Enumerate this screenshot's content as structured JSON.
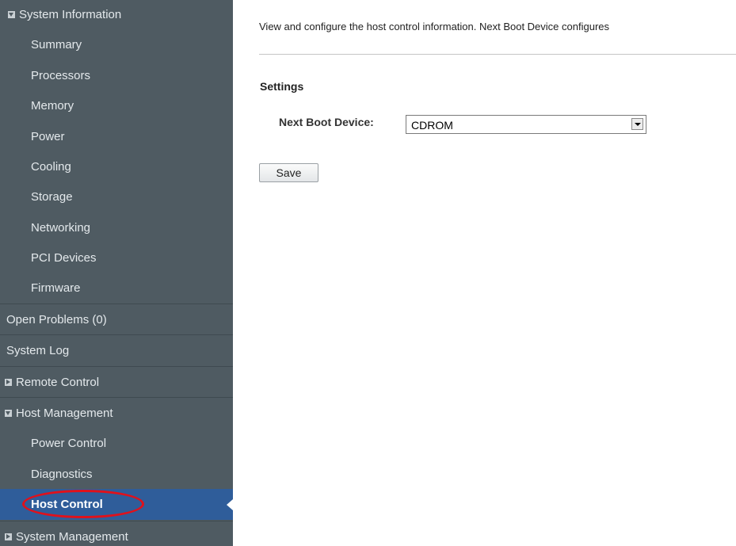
{
  "sidebar": {
    "system_information": "System Information",
    "summary": "Summary",
    "processors": "Processors",
    "memory": "Memory",
    "power": "Power",
    "cooling": "Cooling",
    "storage": "Storage",
    "networking": "Networking",
    "pci_devices": "PCI Devices",
    "firmware": "Firmware",
    "open_problems": "Open Problems (0)",
    "system_log": "System Log",
    "remote_control": "Remote Control",
    "host_management": "Host Management",
    "power_control": "Power Control",
    "diagnostics": "Diagnostics",
    "host_control": "Host Control",
    "system_management": "System Management"
  },
  "main": {
    "description": "View and configure the host control information. Next Boot Device configures",
    "section_title": "Settings",
    "next_boot_label": "Next Boot Device:",
    "next_boot_value": "CDROM",
    "save_label": "Save"
  },
  "icons": {
    "expanded": "triangle-down-icon",
    "collapsed": "triangle-right-icon",
    "dropdown": "chevron-down-icon"
  },
  "colors": {
    "sidebar_bg": "#4f5b62",
    "active_bg": "#2f5d9a",
    "highlight": "#e0111b"
  }
}
